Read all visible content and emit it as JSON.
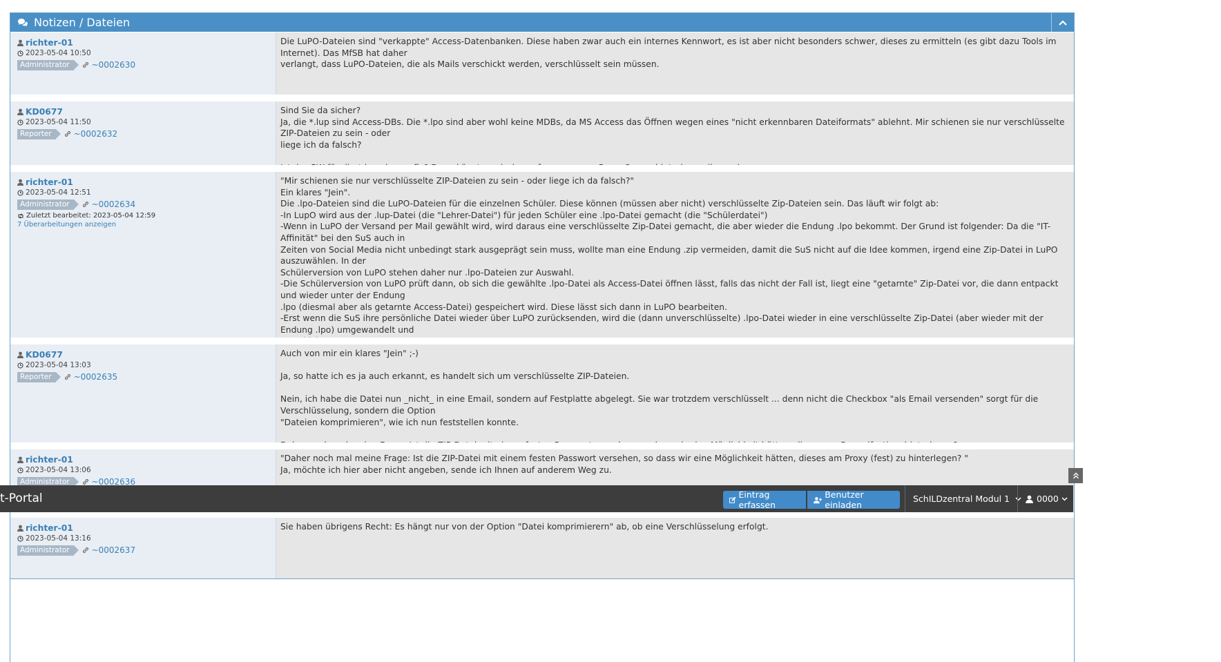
{
  "panel": {
    "title": "Notizen / Dateien"
  },
  "notes": [
    {
      "user": "richter-01",
      "date": "2023-05-04 10:50",
      "role": "Administrator",
      "id": "~0002630",
      "text": "Die LuPO-Dateien sind \"verkappte\" Access-Datenbanken. Diese haben zwar auch ein internes Kennwort, es ist aber nicht besonders schwer, dieses zu ermitteln (es gibt dazu Tools im Internet). Das MfSB hat daher\nverlangt, dass LuPO-Dateien, die als Mails verschickt werden, verschlüsselt sein müssen."
    },
    {
      "user": "KD0677",
      "date": "2023-05-04 11:50",
      "role": "Reporter",
      "id": "~0002632",
      "text": "Sind Sie da sicher?\nJa, die *.lup sind Access-DBs. Die *.lpo sind aber wohl keine MDBs, da MS Access das Öffnen wegen eines \"nicht erkennbaren Dateiformats\" ablehnt. Mir schienen sie nur verschlüsselte ZIP-Dateien zu sein - oder\nliege ich da falsch?\n\nIst das PW für die *.lpo ebenso fix? Dann könnten wir das ggf. an unserem Proxy-Server hinterlegen (lassen)."
    },
    {
      "user": "richter-01",
      "date": "2023-05-04 12:51",
      "role": "Administrator",
      "id": "~0002634",
      "edited": "Zuletzt bearbeitet: 2023-05-04 12:59",
      "revisions": "7 Überarbeitungen anzeigen",
      "text": "\"Mir schienen sie nur verschlüsselte ZIP-Dateien zu sein - oder liege ich da falsch?\"\nEin klares \"Jein\".\nDie .lpo-Dateien sind die LuPO-Dateien für die einzelnen Schüler. Diese können (müssen aber nicht) verschlüsselte Zip-Dateien sein. Das läuft wir folgt ab:\n-In LupO wird aus der .lup-Datei (die \"Lehrer-Datei\") für jeden Schüler eine .lpo-Datei gemacht (die \"Schülerdatei\")\n-Wenn in LuPO der Versand per Mail gewählt wird, wird daraus eine verschlüsselte Zip-Datei gemacht, die aber wieder die Endung .lpo bekommt. Der Grund ist folgender: Da die \"IT-Affinität\" bei den SuS auch in\nZeiten von Social Media nicht unbedingt stark ausgeprägt sein muss, wollte man eine Endung .zip vermeiden, damit die SuS nicht auf die Idee kommen, irgend eine Zip-Datei in LuPO auszuwählen. In der\nSchülerversion von LuPO stehen daher nur .lpo-Dateien zur Auswahl.\n-Die Schülerversion von LuPO prüft dann, ob sich die gewählte .lpo-Datei als Access-Datei öffnen lässt, falls das nicht der Fall ist, liegt eine \"getarnte\" Zip-Datei vor, die dann entpackt und wieder unter der Endung\n.lpo (diesmal aber als getarnte Access-Datei) gespeichert wird. Diese lässt sich dann in LuPO bearbeiten.\n-Erst wenn die SuS ihre persönliche Datei wieder über LuPO zurücksenden, wird die (dann unverschlüsselte) .lpo-Datei wieder in eine verschlüsselte Zip-Datei (aber wieder mit der Endung .lpo) umgewandelt und\nverschickt.\n\nIn Ihrem Fall (\"nicht erkennbares Datenbankformat\") liegt also eine getarnte Zip-Datei vor. Wenn man deren Endung händisch auf .zip ändert, kann man sie auch mit einem Zip-Programm aufrufen und entpacken\n(wenn man das Kennwort weiß)."
    },
    {
      "user": "KD0677",
      "date": "2023-05-04 13:03",
      "role": "Reporter",
      "id": "~0002635",
      "text": "Auch von mir ein klares \"Jein\" ;-)\n\nJa, so hatte ich es ja auch erkannt, es handelt sich um verschlüsselte ZIP-Dateien.\n\nNein, ich habe die Datei nun _nicht_ in eine Email, sondern auf Festplatte abgelegt. Sie war trotzdem verschlüsselt ... denn nicht die Checkbox \"als Email versenden\" sorgt für die Verschlüsselung, sondern die Option\n\"Dateien komprimieren\", wie ich nun feststellen konnte.\n\nDaher noch mal meine Frage: Ist die ZIP-Datei mit einem festen Passwort versehen, so dass wir eine Möglichkeit hätten, dieses am Proxy (fest) zu hinterlegen?"
    },
    {
      "user": "richter-01",
      "date": "2023-05-04 13:06",
      "role": "Administrator",
      "id": "~0002636",
      "text": "\"Daher noch mal meine Frage: Ist die ZIP-Datei mit einem festen Passwort versehen, so dass wir eine Möglichkeit hätten, dieses am Proxy (fest) zu hinterlegen? \"\nJa, möchte ich hier aber nicht angeben, sende ich Ihnen auf anderem Weg zu."
    },
    {
      "user": "richter-01",
      "date": "2023-05-04 13:16",
      "role": "Administrator",
      "id": "~0002637",
      "text": "Sie haben übrigens Recht: Es hängt nur von der Option \"Datei komprimierern\" ab, ob eine Verschlüsselung erfolgt."
    }
  ],
  "navbar": {
    "brand": "rt-Portal",
    "new_entry": "Eintrag erfassen",
    "invite": "Benutzer einladen",
    "project": "SchILDzentral Modul 1",
    "user": "0000"
  },
  "colors": {
    "header": "#4a90c6",
    "navbar": "#3d3d3d",
    "link": "#3a7fb5",
    "button": "#428bca"
  }
}
